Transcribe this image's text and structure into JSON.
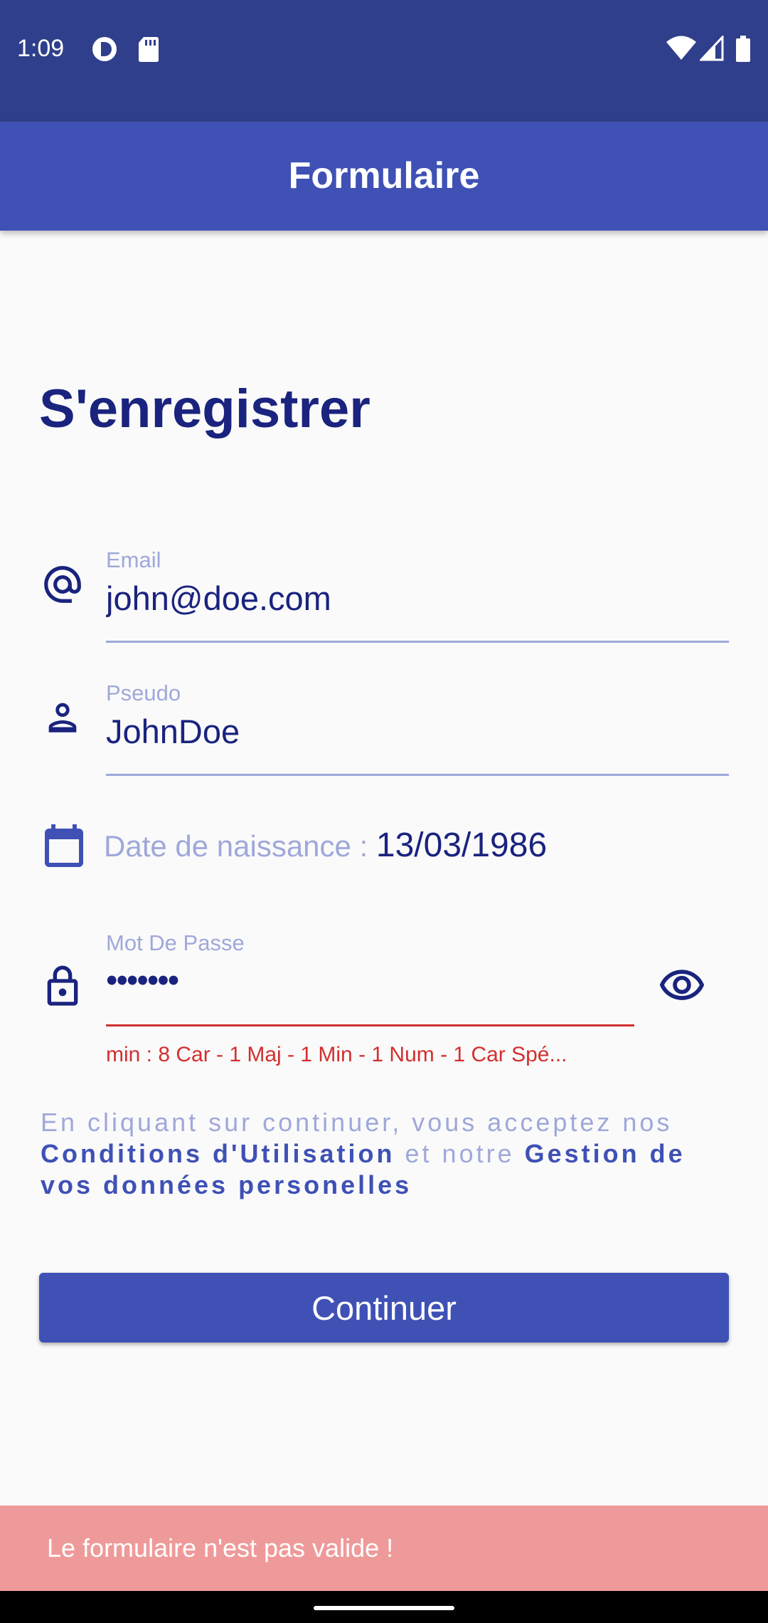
{
  "status_bar": {
    "time": "1:09",
    "icons_left": [
      "data-saver-icon",
      "sd-card-icon"
    ],
    "icons_right": [
      "wifi-icon",
      "cellular-signal-icon",
      "battery-icon"
    ]
  },
  "app_bar": {
    "title": "Formulaire"
  },
  "form": {
    "heading": "S'enregistrer",
    "email": {
      "icon": "at-sign-icon",
      "label": "Email",
      "value": "john@doe.com"
    },
    "pseudo": {
      "icon": "person-icon",
      "label": "Pseudo",
      "value": "JohnDoe"
    },
    "birthdate": {
      "icon": "calendar-icon",
      "label": "Date de naissance : ",
      "value": "13/03/1986"
    },
    "password": {
      "icon": "lock-icon",
      "label": "Mot De Passe",
      "value": "•••••••",
      "toggle_icon": "eye-icon",
      "error": "min : 8 Car - 1 Maj - 1 Min - 1 Num - 1 Car Spé..."
    },
    "terms": {
      "prefix": "En cliquant sur continuer, vous acceptez nos ",
      "link1": "Conditions d'Utilisation",
      "middle": " et notre ",
      "link2": "Gestion de vos données personelles"
    },
    "continue_label": "Continuer"
  },
  "snackbar": {
    "message": "Le formulaire n'est pas valide !"
  },
  "colors": {
    "status_bar": "#303f8b",
    "primary": "#3f51b5",
    "text_dark": "#1a237e",
    "hint": "#9fa8da",
    "error": "#d32f2f",
    "snackbar": "#ef9a9a"
  }
}
